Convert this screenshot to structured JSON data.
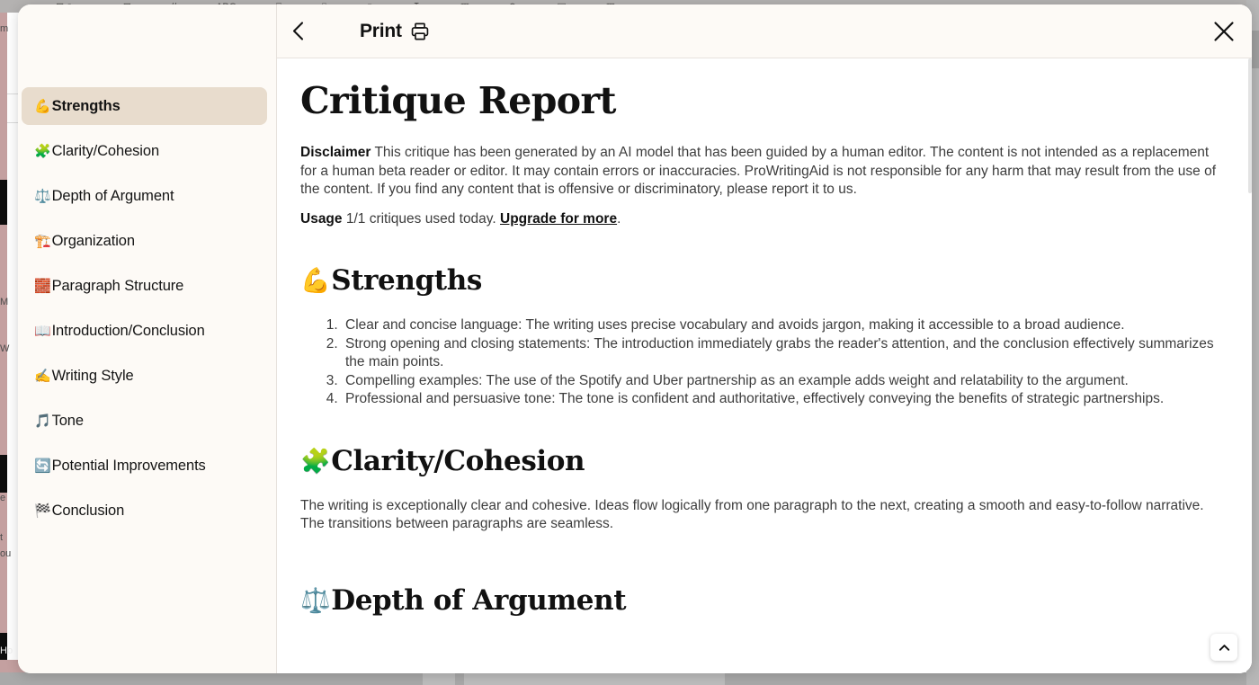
{
  "window": {
    "background_color": "#aeaeae",
    "modal_background": "#fdfaf6",
    "accent_active": "#e8dccd"
  },
  "background_app": {
    "toolbar_glyphs": [
      "⊟⇗ ⌄",
      "⊟",
      "//",
      "ABC",
      "⌸",
      "⌷",
      "⌾",
      "↧",
      "▥",
      "⟳",
      "▤",
      "▦"
    ],
    "side_labels": [
      "m",
      "M",
      "W",
      "e",
      "t",
      "ou"
    ],
    "bottom_label": "Ho"
  },
  "header": {
    "back_icon": "chevron-left-icon",
    "title": "Print",
    "print_icon": "printer-icon",
    "close_icon": "close-icon"
  },
  "sidebar": {
    "items": [
      {
        "emoji": "💪",
        "label": "Strengths",
        "active": true
      },
      {
        "emoji": "🧩",
        "label": "Clarity/Cohesion",
        "active": false
      },
      {
        "emoji": "⚖️",
        "label": "Depth of Argument",
        "active": false
      },
      {
        "emoji": "🏗️",
        "label": "Organization",
        "active": false
      },
      {
        "emoji": "🧱",
        "label": "Paragraph Structure",
        "active": false
      },
      {
        "emoji": "📖",
        "label": "Introduction/Conclusion",
        "active": false
      },
      {
        "emoji": "✍️",
        "label": "Writing Style",
        "active": false
      },
      {
        "emoji": "🎵",
        "label": "Tone",
        "active": false
      },
      {
        "emoji": "🔄",
        "label": "Potential Improvements",
        "active": false
      },
      {
        "emoji": "🏁",
        "label": "Conclusion",
        "active": false
      }
    ]
  },
  "document": {
    "title": "Critique Report",
    "disclaimer": {
      "label": "Disclaimer",
      "text": " This critique has been generated by an AI model that has been guided by a human editor. The content is not intended as a replacement for a human beta reader or editor. It may contain errors or inaccuracies. ProWritingAid is not responsible for any harm that may result from the use of the content. If you find any content that is offensive or discriminatory, please report it to us."
    },
    "usage": {
      "label": "Usage",
      "text": " 1/1 critiques used today. ",
      "link": "Upgrade for more",
      "suffix": "."
    },
    "sections": [
      {
        "emoji": "💪",
        "heading": "Strengths",
        "type": "ordered-list",
        "items": [
          "Clear and concise language: The writing uses precise vocabulary and avoids jargon, making it accessible to a broad audience.",
          "Strong opening and closing statements: The introduction immediately grabs the reader's attention, and the conclusion effectively summarizes the main points.",
          "Compelling examples: The use of the Spotify and Uber partnership as an example adds weight and relatability to the argument.",
          "Professional and persuasive tone: The tone is confident and authoritative, effectively conveying the benefits of strategic partnerships."
        ]
      },
      {
        "emoji": "🧩",
        "heading": "Clarity/Cohesion",
        "type": "paragraph",
        "body": "The writing is exceptionally clear and cohesive. Ideas flow logically from one paragraph to the next, creating a smooth and easy-to-follow narrative. The transitions between paragraphs are seamless."
      },
      {
        "emoji": "⚖️",
        "heading": "Depth of Argument",
        "type": "heading-only",
        "body": ""
      }
    ]
  },
  "controls": {
    "scroll_top_icon": "chevron-up-icon"
  }
}
